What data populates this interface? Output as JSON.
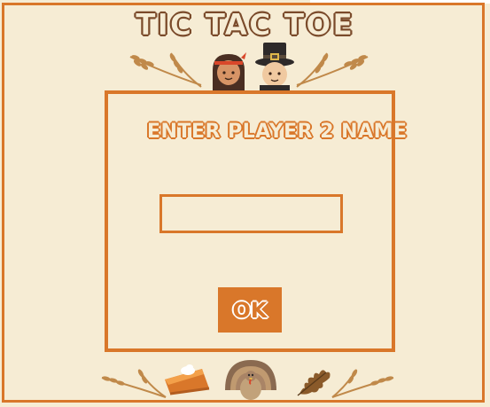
{
  "game": {
    "title": "TIC TAC TOE",
    "prompt": "ENTER PLAYER 2 NAME",
    "name_input_value": "",
    "ok_label": "OK"
  },
  "colors": {
    "background": "#f6ecd4",
    "accent": "#d9772a",
    "title": "#7a4a2a"
  },
  "decorations": {
    "top": [
      "wheat-icon",
      "native-girl-icon",
      "pilgrim-icon",
      "wheat-icon"
    ],
    "bottom": [
      "wheat-icon",
      "pumpkin-pie-icon",
      "turkey-icon",
      "oak-leaf-icon",
      "wheat-icon"
    ]
  }
}
